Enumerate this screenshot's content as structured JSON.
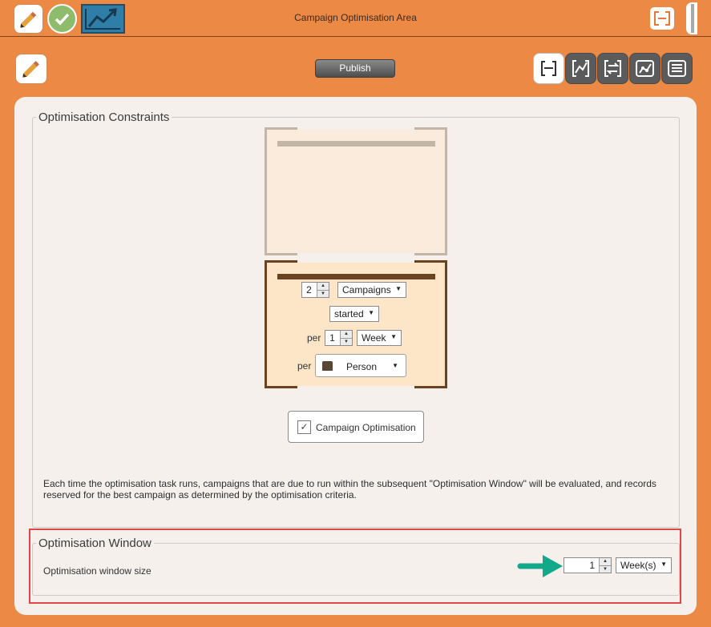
{
  "titlebar": {
    "title": "Campaign Optimisation Area",
    "icons": [
      "pencil-icon",
      "check-icon",
      "trend-chart-icon",
      "focus-bracket-icon",
      "collapse-handle"
    ]
  },
  "toolbar": {
    "publish_label": "Publish",
    "view_buttons": [
      "bracket-view-icon",
      "line-chart-icon",
      "cycle-icon",
      "scatter-chart-icon",
      "list-icon"
    ],
    "active_view": 0
  },
  "constraints": {
    "legend": "Optimisation Constraints",
    "count_value": "2",
    "entity_select": "Campaigns",
    "status_select": "started",
    "per_label": "per",
    "period_value": "1",
    "period_unit_select": "Week",
    "per_label_2": "per",
    "audience_select": "Person",
    "campaign_opt_label": "Campaign Optimisation",
    "campaign_opt_checked": true,
    "description": "Each time the optimisation task runs, campaigns that are due to run within the subsequent \"Optimisation Window\" will be evaluated, and records reserved for the best campaign as determined by the optimisation criteria."
  },
  "window": {
    "legend": "Optimisation Window",
    "size_label": "Optimisation window size",
    "size_value": "1",
    "unit_select": "Week(s)"
  },
  "colors": {
    "accent_orange": "#ec8944",
    "panel_bg": "#f5f0eb",
    "highlight_red": "#e04848",
    "arrow_teal": "#12a88a"
  }
}
